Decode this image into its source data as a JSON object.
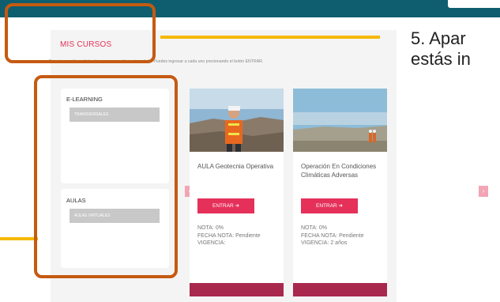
{
  "page": {
    "section_title": "MIS CURSOS",
    "description": "En esta sección se listan los cursos que tienes inscrito/a. Puedes ingresar a cada uno presionando el botón ENTRAR."
  },
  "sidebar": {
    "groups": [
      {
        "title": "E-LEARNING",
        "button": "TRANSVERSALES"
      },
      {
        "title": "AULAS",
        "button": "AULAS VIRTUALES"
      }
    ]
  },
  "courses": [
    {
      "name": "AULA Geotecnia Operativa",
      "enter_label": "ENTRAR",
      "nota": "NOTA: 0%",
      "fecha_nota": "FECHA NOTA: Pendiente",
      "vigencia": "VIGENCIA:"
    },
    {
      "name": "Operación En Condiciones Climáticas Adversas",
      "enter_label": "ENTRAR",
      "nota": "NOTA: 0%",
      "fecha_nota": "FECHA NOTA: Pendiente",
      "vigencia": "VIGENCIA: 2 años"
    }
  ],
  "carousel": {
    "prev_icon": "chevron-left-icon",
    "next_icon": "chevron-right-icon"
  },
  "instruction": {
    "line1": "5. Apar",
    "line2": "estás in"
  },
  "colors": {
    "topbar": "#0f5e70",
    "accent": "#e5305a",
    "annotation": "#c55a11",
    "highlight": "#f5b800"
  }
}
